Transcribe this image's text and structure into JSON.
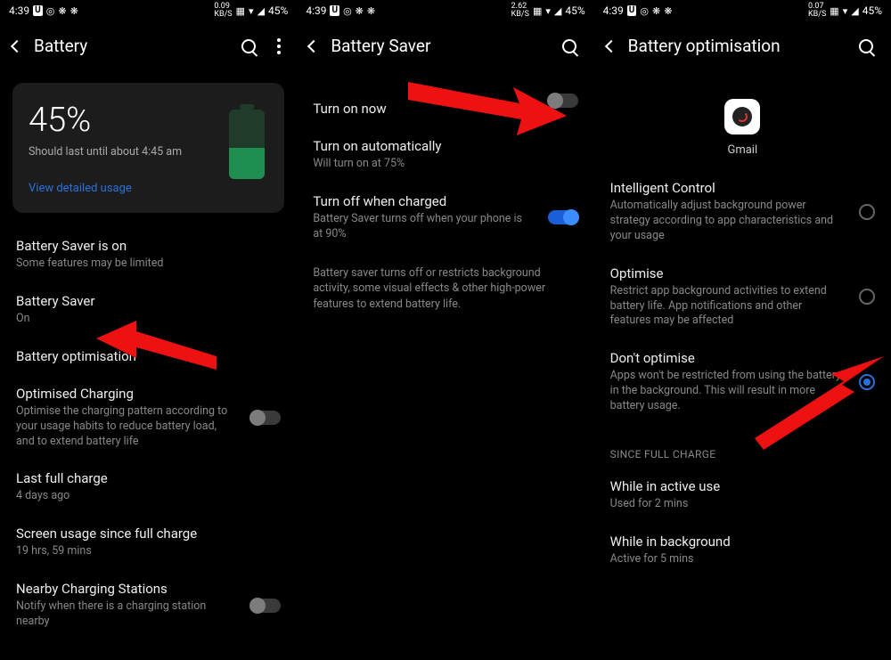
{
  "statusbar": {
    "time": "4:39",
    "kbps_1": "0.09",
    "kbps_2": "2.62",
    "kbps_3": "0.07",
    "kbps_label": "KB/S",
    "battery_pct": "45%"
  },
  "screen1": {
    "title": "Battery",
    "card": {
      "pct": "45%",
      "subtitle": "Should last until about 4:45 am",
      "link": "View detailed usage"
    },
    "saver_status": {
      "title": "Battery Saver is on",
      "sub": "Some features may be limited"
    },
    "saver": {
      "title": "Battery Saver",
      "sub": "On"
    },
    "optimisation": {
      "title": "Battery optimisation"
    },
    "optimised_charging": {
      "title": "Optimised Charging",
      "sub": "Optimise the charging pattern according to your usage habits to reduce battery load, and to extend battery life"
    },
    "last_charge": {
      "title": "Last full charge",
      "sub": "4 days ago"
    },
    "screen_usage": {
      "title": "Screen usage since full charge",
      "sub": "19 hrs, 59 mins"
    },
    "nearby": {
      "title": "Nearby Charging Stations",
      "sub": "Notify when there is a charging station nearby"
    }
  },
  "screen2": {
    "title": "Battery Saver",
    "turn_on_now": "Turn on now",
    "auto": {
      "title": "Turn on automatically",
      "sub": "Will turn on at 75%"
    },
    "off_charged": {
      "title": "Turn off when charged",
      "sub": "Battery Saver turns off when your phone is at 90%"
    },
    "para": "Battery saver turns off or restricts background activity, some visual effects & other high-power features to extend battery life."
  },
  "screen3": {
    "title": "Battery optimisation",
    "app_name": "Gmail",
    "intelligent": {
      "title": "Intelligent Control",
      "sub": "Automatically adjust background power strategy according to app characteristics and your usage"
    },
    "optimise": {
      "title": "Optimise",
      "sub": "Restrict app background activities to extend battery life. App notifications and other features may be affected"
    },
    "dont": {
      "title": "Don't optimise",
      "sub": "Apps won't be restricted from using the battery in the background. This will result in more battery usage."
    },
    "section": "SINCE FULL CHARGE",
    "active": {
      "title": "While in active use",
      "sub": "Used for 2 mins"
    },
    "background": {
      "title": "While in background",
      "sub": "Active for 5 mins"
    }
  }
}
